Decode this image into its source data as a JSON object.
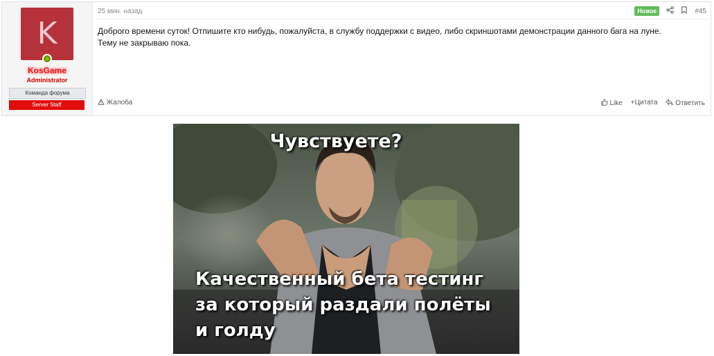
{
  "user": {
    "avatar_letter": "K",
    "name": "KosGame",
    "title": "Administrator",
    "badge_team": "Команда форума",
    "badge_staff": "Server Staff"
  },
  "post": {
    "time": "25 мин. назад",
    "new_label": "Новое",
    "number": "#45",
    "message_line1": "Доброго времени суток! Отпишите кто нибудь, пожалуйста, в службу поддержки с видео, либо скриншотами демонстрации данного бага на луне.",
    "message_line2": "Тему не закрываю пока.",
    "report_label": "Жалоба",
    "like_label": "Like",
    "quote_label": "Цитата",
    "reply_label": "Ответить"
  },
  "icons": {
    "share": "share-icon",
    "bookmark": "bookmark-icon",
    "warning": "warning-icon",
    "like": "thumbs-up-icon",
    "quote": "plus-icon",
    "reply": "reply-icon"
  },
  "meme": {
    "top_caption": "Чувствуете?",
    "bottom_line1": "Качественный бета тестинг",
    "bottom_line2": "за который раздали полёты",
    "bottom_line3": "и голду"
  },
  "colors": {
    "username": "#e31e24",
    "new_badge": "#63b95a",
    "staff_badge": "#e20d0d",
    "avatar_bg": "#b5323a"
  }
}
